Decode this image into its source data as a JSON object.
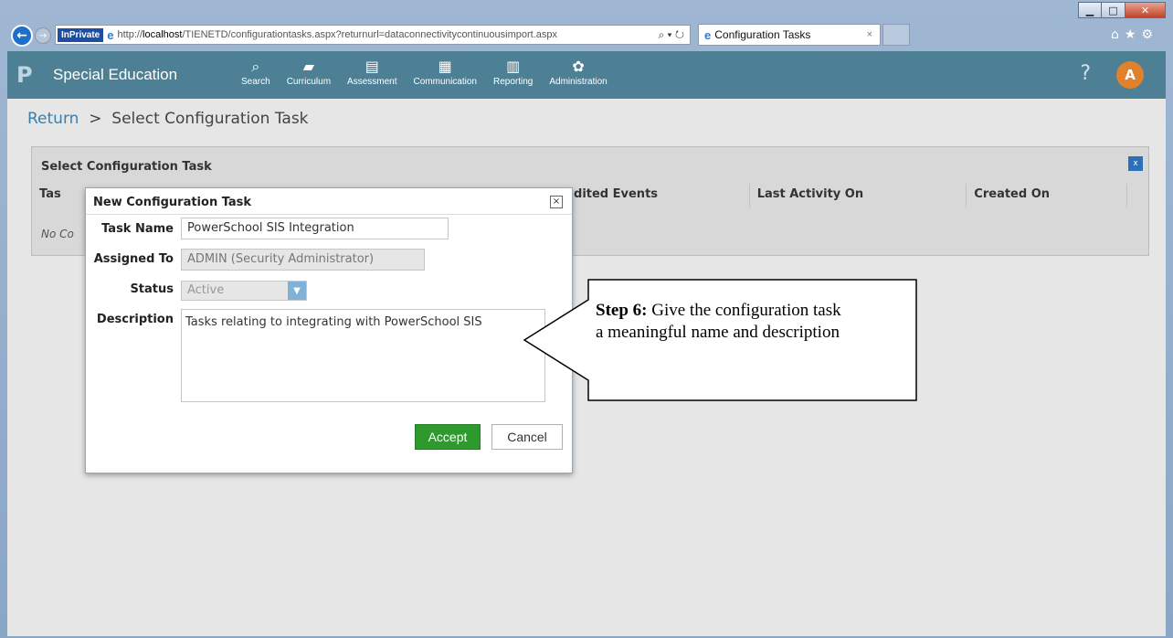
{
  "browser": {
    "inprivate": "InPrivate",
    "url_prefix": "http://",
    "url_host": "localhost",
    "url_path": "/TIENETD/configurationtasks.aspx?returnurl=dataconnectivitycontinuousimport.aspx",
    "addr_tools": "⌕ ▾ ↻",
    "tab_title": "Configuration Tasks",
    "tab_close": "×"
  },
  "app": {
    "title": "Special Education",
    "menu": [
      {
        "label": "Search",
        "icon": "⌕"
      },
      {
        "label": "Curriculum",
        "icon": "▰"
      },
      {
        "label": "Assessment",
        "icon": "▤"
      },
      {
        "label": "Communication",
        "icon": "▦"
      },
      {
        "label": "Reporting",
        "icon": "▥"
      },
      {
        "label": "Administration",
        "icon": "✿"
      }
    ],
    "help": "?",
    "avatar": "A"
  },
  "breadcrumb": {
    "return_label": "Return",
    "separator": ">",
    "current": "Select Configuration Task"
  },
  "panel": {
    "title": "Select Configuration Task",
    "columns": [
      "Tas",
      "dited Events",
      "Last Activity On",
      "Created On"
    ],
    "empty_text": "No Co"
  },
  "dialog": {
    "title": "New Configuration Task",
    "close": "×",
    "task_name_label": "Task Name",
    "task_name_value": "PowerSchool SIS Integration",
    "assigned_to_label": "Assigned To",
    "assigned_to_value": "ADMIN (Security Administrator)",
    "status_label": "Status",
    "status_value": "Active",
    "description_label": "Description",
    "description_value": "Tasks relating to integrating with PowerSchool SIS",
    "accept": "Accept",
    "cancel": "Cancel"
  },
  "callout": {
    "step": "Step 6:",
    "line1": " Give the configuration task",
    "line2": "a meaningful name and description"
  }
}
